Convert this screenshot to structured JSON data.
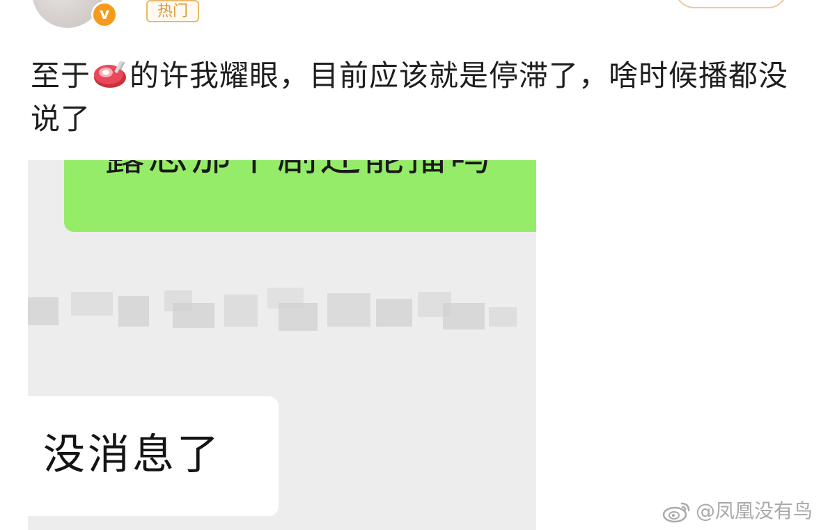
{
  "header": {
    "verified_badge": "v",
    "hot_tag": "热门"
  },
  "post": {
    "text_before_icon": "至于",
    "icon": "steak-emoji-icon",
    "text_after_icon": "的许我耀眼，目前应该就是停滞了，啥时候播都没说了"
  },
  "chat": {
    "outgoing_message": "露思那个剧还能播吗",
    "incoming_message": "没消息了",
    "outgoing_color": "#95ec69",
    "background_color": "#ededed"
  },
  "watermark": {
    "text": "@凤凰没有鸟",
    "icon": "weibo-logo-icon"
  }
}
